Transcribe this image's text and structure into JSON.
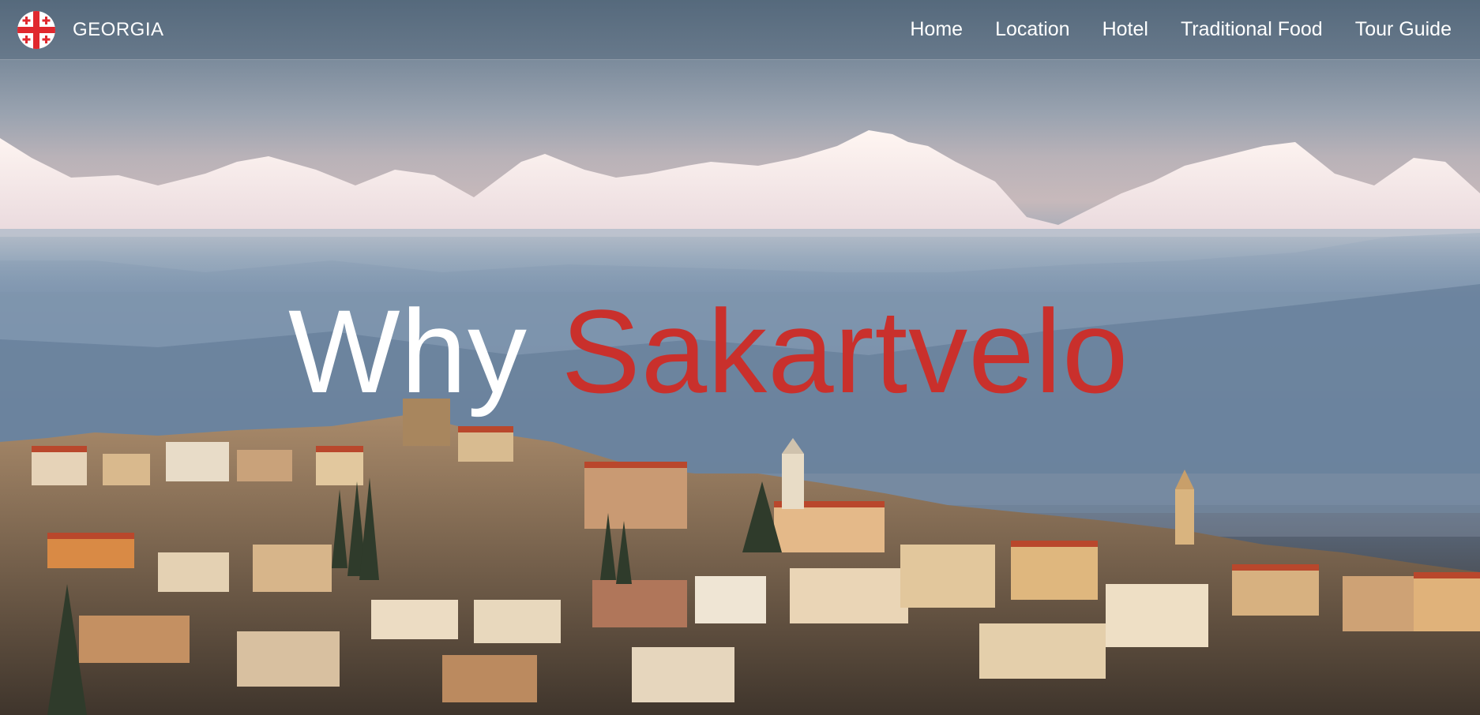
{
  "brand": {
    "name": "GEORGIA",
    "logo_icon": "georgian-flag-icon"
  },
  "nav": {
    "items": [
      {
        "label": "Home"
      },
      {
        "label": "Location"
      },
      {
        "label": "Hotel"
      },
      {
        "label": "Traditional Food"
      },
      {
        "label": "Tour Guide"
      }
    ]
  },
  "hero": {
    "headline_part1": "Why",
    "headline_part2": "Sakartvelo",
    "accent_color": "#c9302c",
    "text_color": "#ffffff",
    "background": "photo of snow-capped mountains above a hillside town"
  }
}
